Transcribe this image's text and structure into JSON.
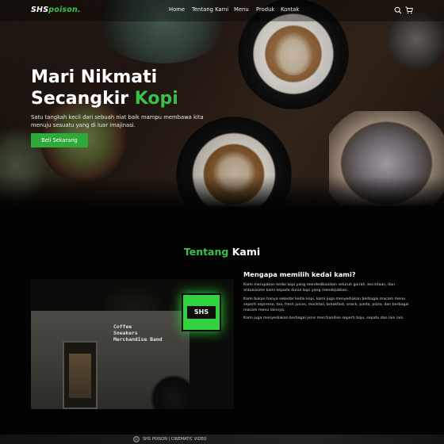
{
  "nav": {
    "logo_main": "SHS",
    "logo_accent": "poison.",
    "menu": [
      "Home",
      "Tentang Kami",
      "Menu",
      "Produk",
      "Kontak"
    ],
    "icons": [
      "search-icon",
      "cart-icon"
    ]
  },
  "hero": {
    "title_line1": "Mari Nikmati",
    "title_line2": "Secangkir",
    "title_accent": "Kopi",
    "subtitle": "Satu tangkah kecil dari sebuah niat baik mampu membawa kita menuju sesuatu yang di luar imajinasi.",
    "cta": "Beli Sekarang"
  },
  "about": {
    "title_accent": "Tentang",
    "title_main": "Kami",
    "heading": "Mengapa memilih kedai kami?",
    "paragraphs": [
      "Kami merupakan kedai kopi yang mendedikasikan seluruh gairah, kecintaan, dan antusiasme kami kepada dunia kopi yang menakjubkan.",
      "Kami bukan hanya sekedar kedai kopi, kami juga menyediakan berbagai macam menu seperti espresso, tea, fresh juices, mocktail, breakfast, snack, pasta, pizza, dan berbagai macam menu lainnya.",
      "Kami juga menyediakan berbagai jenis merchandise seperti baju, sepatu dan lain lain."
    ],
    "image_sign": "SHS",
    "image_wall_text": [
      "Coffee",
      "Sneakers",
      "Merchandise Band"
    ]
  },
  "video": {
    "label": "SHS POISON | CINEMATIC VIDEO"
  },
  "colors": {
    "accent": "#3bc14a",
    "button": "#2fa93a",
    "background": "#030303"
  }
}
